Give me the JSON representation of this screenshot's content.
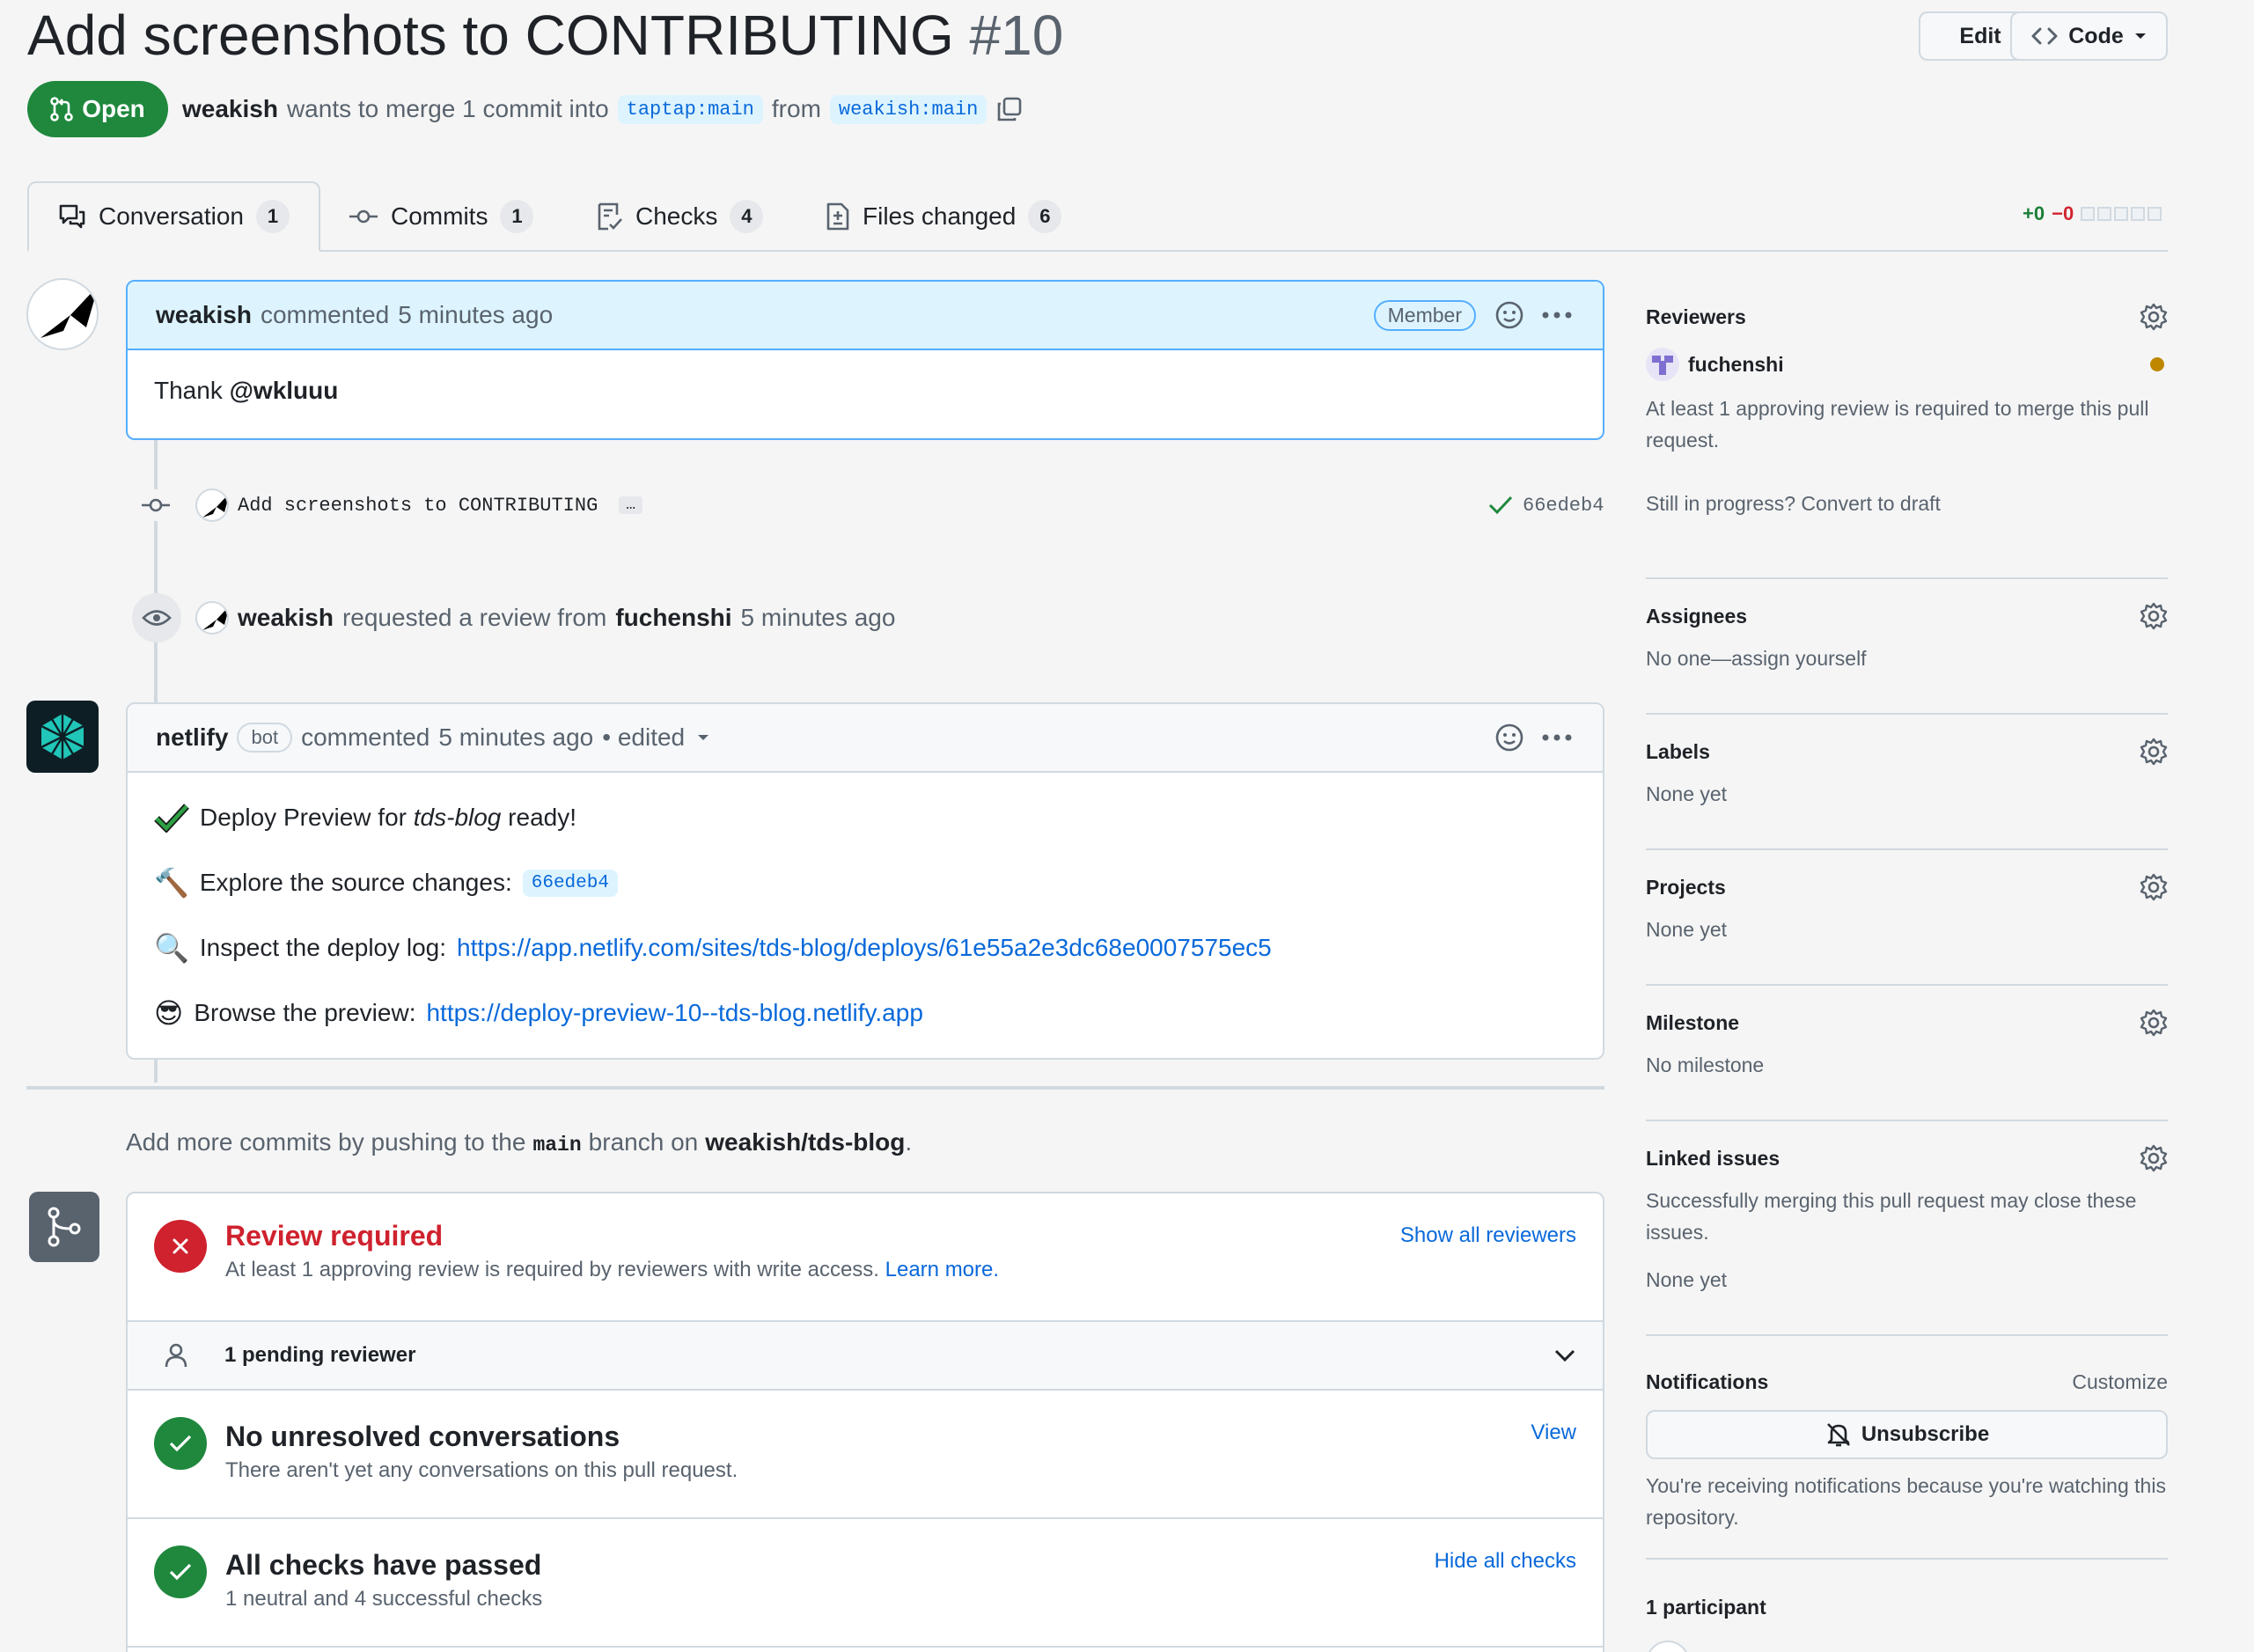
{
  "header": {
    "title": "Add screenshots to CONTRIBUTING",
    "number": "#10",
    "edit_label": "Edit",
    "code_label": "Code",
    "state": "Open",
    "author": "weakish",
    "merge_text_1": "wants to merge 1 commit into",
    "base_branch": "taptap:main",
    "from_text": "from",
    "head_branch": "weakish:main"
  },
  "tabs": [
    {
      "label": "Conversation",
      "count": "1"
    },
    {
      "label": "Commits",
      "count": "1"
    },
    {
      "label": "Checks",
      "count": "4"
    },
    {
      "label": "Files changed",
      "count": "6"
    }
  ],
  "diffstat": {
    "additions": "+0",
    "deletions": "−0"
  },
  "timeline": {
    "comment1": {
      "author": "weakish",
      "action": "commented",
      "time": "5 minutes ago",
      "badge": "Member",
      "body_prefix": "Thank ",
      "mention": "@wkluuu"
    },
    "commit": {
      "message": "Add screenshots to CONTRIBUTING",
      "ellipsis": "…",
      "sha": "66edeb4"
    },
    "review_request": {
      "actor": "weakish",
      "text": "requested a review from",
      "reviewer": "fuchenshi",
      "time": "5 minutes ago"
    },
    "comment2": {
      "author": "netlify",
      "bot_label": "bot",
      "action": "commented",
      "time": "5 minutes ago",
      "edited": "• edited",
      "lines": [
        {
          "emoji": "✔",
          "prefix": "Deploy Preview for ",
          "em": "tds-blog",
          "suffix": " ready!"
        },
        {
          "emoji": "🔨",
          "prefix": "Explore the source changes: ",
          "chip": "66edeb4"
        },
        {
          "emoji": "🔍",
          "prefix": "Inspect the deploy log: ",
          "link": "https://app.netlify.com/sites/tds-blog/deploys/61e55a2e3dc68e0007575ec5"
        },
        {
          "emoji": "😎",
          "prefix": "Browse the preview: ",
          "link": "https://deploy-preview-10--tds-blog.netlify.app"
        }
      ]
    },
    "push_hint": {
      "prefix": "Add more commits by pushing to the",
      "branch": "main",
      "middle": "branch on",
      "repo": "weakish/tds-blog",
      "suffix": "."
    }
  },
  "merge_box": {
    "review": {
      "title": "Review required",
      "subtitle": "At least 1 approving review is required by reviewers with write access.",
      "learn_more": "Learn more.",
      "action": "Show all reviewers"
    },
    "pending": "1 pending reviewer",
    "conversations": {
      "title": "No unresolved conversations",
      "subtitle": "There aren't yet any conversations on this pull request.",
      "action": "View"
    },
    "checks": {
      "title": "All checks have passed",
      "subtitle": "1 neutral and 4 successful checks",
      "action": "Hide all checks"
    }
  },
  "sidebar": {
    "reviewers": {
      "heading": "Reviewers",
      "name": "fuchenshi",
      "note": "At least 1 approving review is required to merge this pull request.",
      "draft": "Still in progress? Convert to draft"
    },
    "assignees": {
      "heading": "Assignees",
      "value": "No one—assign yourself"
    },
    "labels": {
      "heading": "Labels",
      "value": "None yet"
    },
    "projects": {
      "heading": "Projects",
      "value": "None yet"
    },
    "milestone": {
      "heading": "Milestone",
      "value": "No milestone"
    },
    "linked": {
      "heading": "Linked issues",
      "note": "Successfully merging this pull request may close these issues.",
      "value": "None yet"
    },
    "notifications": {
      "heading": "Notifications",
      "customize": "Customize",
      "button": "Unsubscribe",
      "note": "You're receiving notifications because you're watching this repository."
    },
    "participants": {
      "heading": "1 participant"
    }
  },
  "colors": {
    "open_green": "#1f883d",
    "danger": "#cf222e",
    "success": "#1f883d",
    "link": "#0969da",
    "pending_dot": "#bf8700"
  }
}
